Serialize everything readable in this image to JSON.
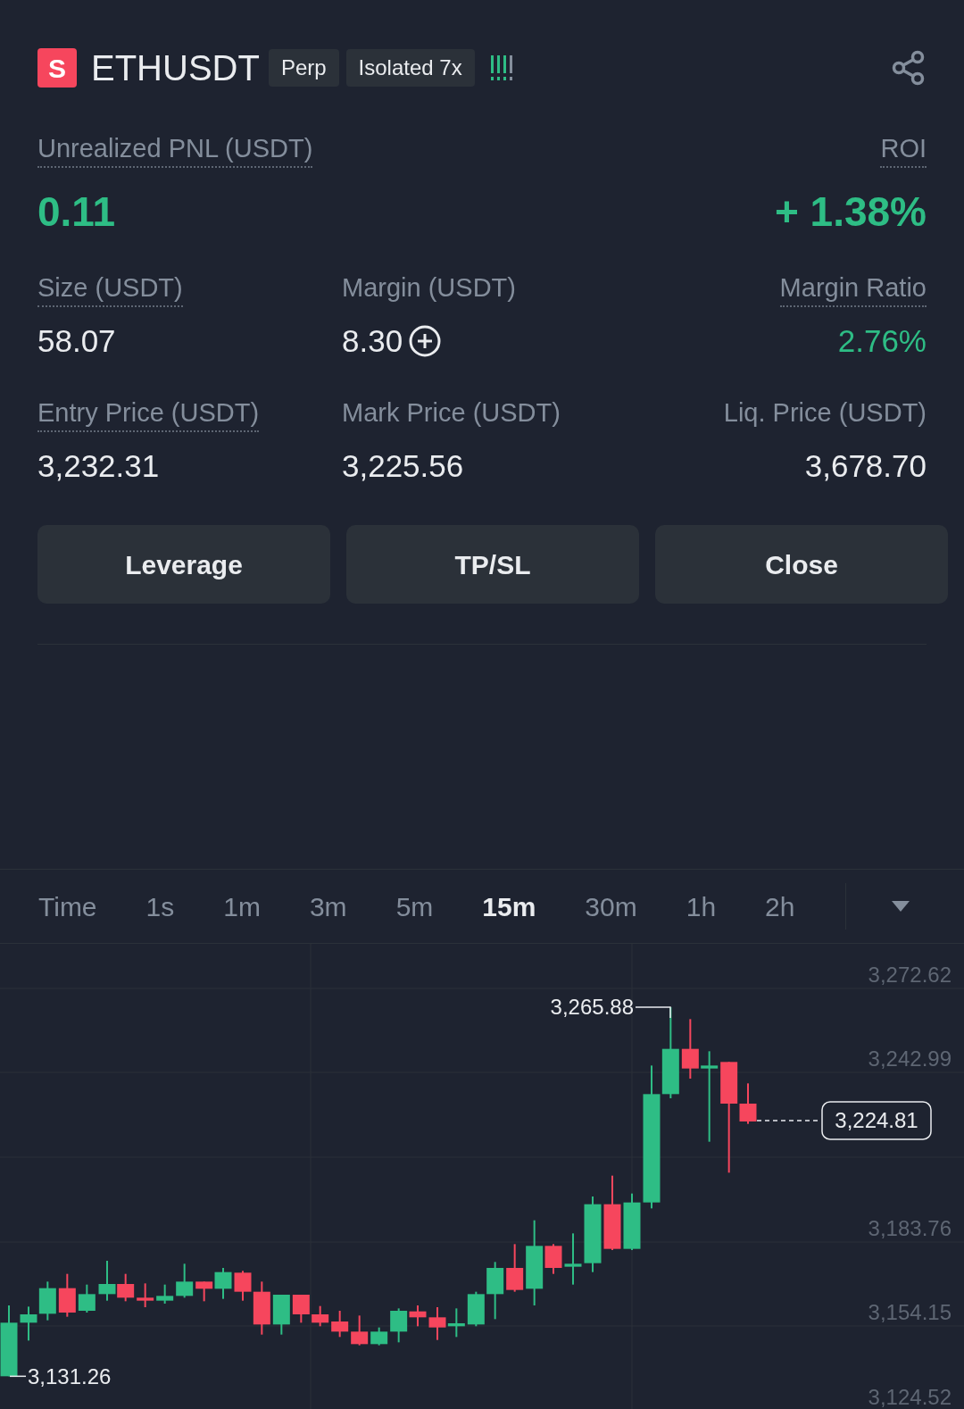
{
  "header": {
    "badge": "S",
    "symbol": "ETHUSDT",
    "tags": [
      "Perp",
      "Isolated 7x"
    ]
  },
  "summary": [
    {
      "label": "Unrealized PNL (USDT)",
      "value": "0.11",
      "dotted": true,
      "positive": true
    },
    {
      "label": "ROI",
      "value": "+ 1.38%",
      "dotted": true,
      "positive": true
    }
  ],
  "stats": [
    {
      "label": "Size (USDT)",
      "value": "58.07",
      "dotted": true,
      "positive": false,
      "add_button": false
    },
    {
      "label": "Margin (USDT)",
      "value": "8.30",
      "dotted": false,
      "positive": false,
      "add_button": true
    },
    {
      "label": "Margin Ratio",
      "value": "2.76%",
      "dotted": true,
      "positive": true,
      "add_button": false
    },
    {
      "label": "Entry Price (USDT)",
      "value": "3,232.31",
      "dotted": true,
      "positive": false,
      "add_button": false
    },
    {
      "label": "Mark Price (USDT)",
      "value": "3,225.56",
      "dotted": false,
      "positive": false,
      "add_button": false
    },
    {
      "label": "Liq. Price (USDT)",
      "value": "3,678.70",
      "dotted": false,
      "positive": false,
      "add_button": false
    }
  ],
  "actions": [
    "Leverage",
    "TP/SL",
    "Close"
  ],
  "intervals": [
    {
      "label": "Time",
      "selected": false
    },
    {
      "label": "1s",
      "selected": false
    },
    {
      "label": "1m",
      "selected": false
    },
    {
      "label": "3m",
      "selected": false
    },
    {
      "label": "5m",
      "selected": false
    },
    {
      "label": "15m",
      "selected": true
    },
    {
      "label": "30m",
      "selected": false
    },
    {
      "label": "1h",
      "selected": false
    },
    {
      "label": "2h",
      "selected": false
    }
  ],
  "chart": {
    "y_labels": [
      "3,272.62",
      "3,242.99",
      "3,183.76",
      "3,154.15",
      "3,124.52"
    ],
    "high_label": "3,265.88",
    "low_label": "3,131.26",
    "last_price": "3,224.81"
  }
}
